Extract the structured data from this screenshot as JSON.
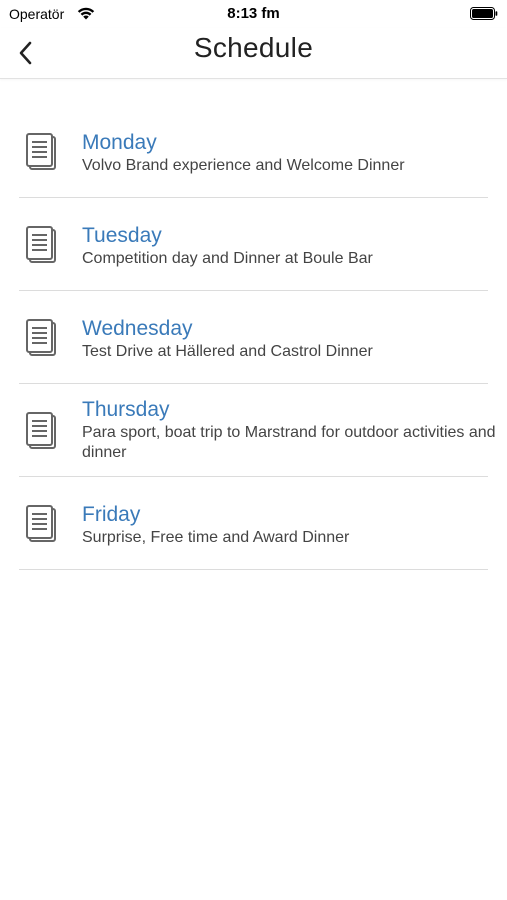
{
  "status_bar": {
    "carrier": "Operatör",
    "time": "8:13 fm",
    "icons": [
      "wifi-icon",
      "battery-icon"
    ]
  },
  "nav": {
    "title": "Schedule",
    "back_icon": "chevron-left-icon"
  },
  "schedule": {
    "items": [
      {
        "day": "Monday",
        "description": "Volvo Brand experience and Welcome Dinner",
        "icon": "document-icon"
      },
      {
        "day": "Tuesday",
        "description": "Competition day and Dinner at Boule Bar",
        "icon": "document-icon"
      },
      {
        "day": "Wednesday",
        "description": "Test Drive at Hällered and Castrol Dinner",
        "icon": "document-icon"
      },
      {
        "day": "Thursday",
        "description": "Para sport, boat trip to Marstrand for outdoor activities and dinner",
        "icon": "document-icon"
      },
      {
        "day": "Friday",
        "description": "Surprise, Free time and Award Dinner",
        "icon": "document-icon"
      }
    ]
  },
  "colors": {
    "accent": "#3a7ab9",
    "text": "#444444",
    "divider": "#dcdcdc",
    "icon": "#5a5a5a"
  }
}
